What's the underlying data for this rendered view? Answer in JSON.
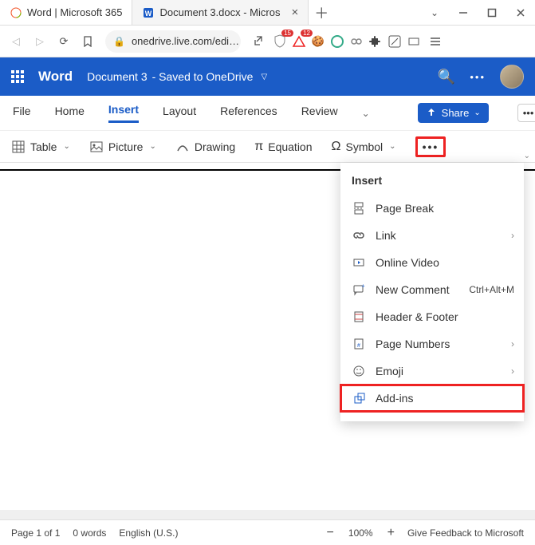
{
  "browser": {
    "tabs": [
      {
        "label": "Word | Microsoft 365"
      },
      {
        "label": "Document 3.docx - Micros"
      }
    ],
    "url": "onedrive.live.com/edi…",
    "ext_badges": {
      "shield": "15",
      "triangle": "12"
    }
  },
  "word": {
    "app": "Word",
    "doc_name": "Document 3",
    "save_status": "- Saved to OneDrive"
  },
  "ribbon": {
    "tabs": [
      "File",
      "Home",
      "Insert",
      "Layout",
      "References",
      "Review"
    ],
    "active": "Insert",
    "share": "Share"
  },
  "insert_toolbar": {
    "table": "Table",
    "picture": "Picture",
    "drawing": "Drawing",
    "equation": "Equation",
    "symbol": "Symbol"
  },
  "insert_menu": {
    "title": "Insert",
    "items": {
      "page_break": "Page Break",
      "link": "Link",
      "online_video": "Online Video",
      "new_comment": "New Comment",
      "new_comment_shortcut": "Ctrl+Alt+M",
      "header_footer": "Header & Footer",
      "page_numbers": "Page Numbers",
      "emoji": "Emoji",
      "addins": "Add-ins"
    }
  },
  "status": {
    "page": "Page 1 of 1",
    "words": "0 words",
    "language": "English (U.S.)",
    "zoom": "100%",
    "feedback": "Give Feedback to Microsoft"
  }
}
